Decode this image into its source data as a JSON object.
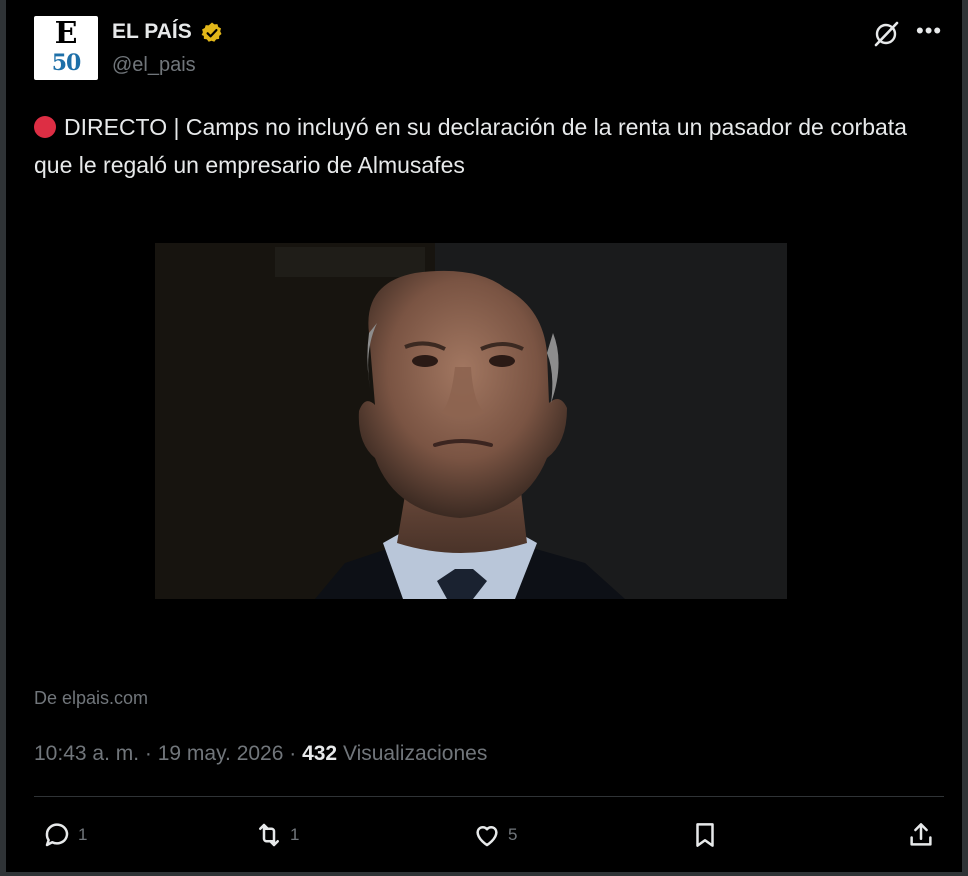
{
  "author": {
    "name": "EL PAÍS",
    "handle": "@el_pais",
    "avatar_letter": "E",
    "avatar_number": "50"
  },
  "icons": {
    "verified": "verified-badge-icon",
    "grok": "grok-icon",
    "more": "more-options-icon"
  },
  "tweet": {
    "text": "DIRECTO | Camps no incluyó en su declaración de la renta un pasador de corbata que le regaló un empresario de Almusafes",
    "source": "De elpais.com",
    "time": "10:43 a. m. · 19 may. 2026 · ",
    "views_count": "432",
    "views_label": " Visualizaciones"
  },
  "actions": {
    "replies": "1",
    "reposts": "1",
    "likes": "5"
  },
  "colors": {
    "accent_live": "#dd2e44",
    "verified_gold": "#e2b719",
    "text_primary": "#e7e9ea",
    "text_secondary": "#71767b"
  }
}
